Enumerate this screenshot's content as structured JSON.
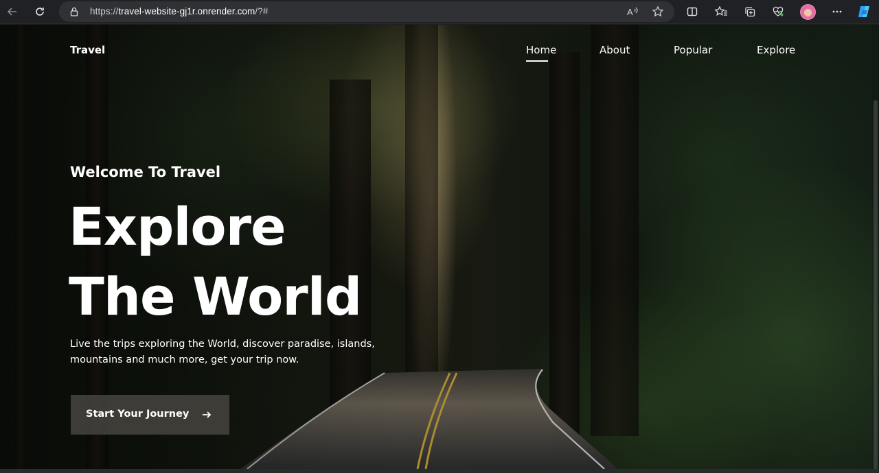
{
  "browser": {
    "url_scheme": "https://",
    "url_host": "travel-website-gj1r.onrender.com",
    "url_path": "/?#",
    "icons": [
      "back-icon",
      "refresh-icon",
      "lock-icon",
      "read-aloud-icon",
      "favorite-star-icon",
      "split-screen-icon",
      "favorites-icon",
      "collections-icon",
      "browser-essentials-icon",
      "profile-avatar",
      "more-menu-icon",
      "copilot-icon"
    ]
  },
  "site": {
    "logo": "Travel",
    "nav": [
      {
        "label": "Home",
        "active": true
      },
      {
        "label": "About",
        "active": false
      },
      {
        "label": "Popular",
        "active": false
      },
      {
        "label": "Explore",
        "active": false
      }
    ]
  },
  "hero": {
    "subtitle": "Welcome To Travel",
    "title_line1": "Explore",
    "title_line2": "The World",
    "description_line1": "Live the trips exploring the World, discover paradise, islands,",
    "description_line2": "mountains and much more, get your trip now.",
    "cta_label": "Start Your Journey",
    "cta_icon": "arrow-right-icon"
  },
  "colors": {
    "text": "#ffffff",
    "cta_background": "#46443f",
    "chrome_background": "#202124"
  }
}
